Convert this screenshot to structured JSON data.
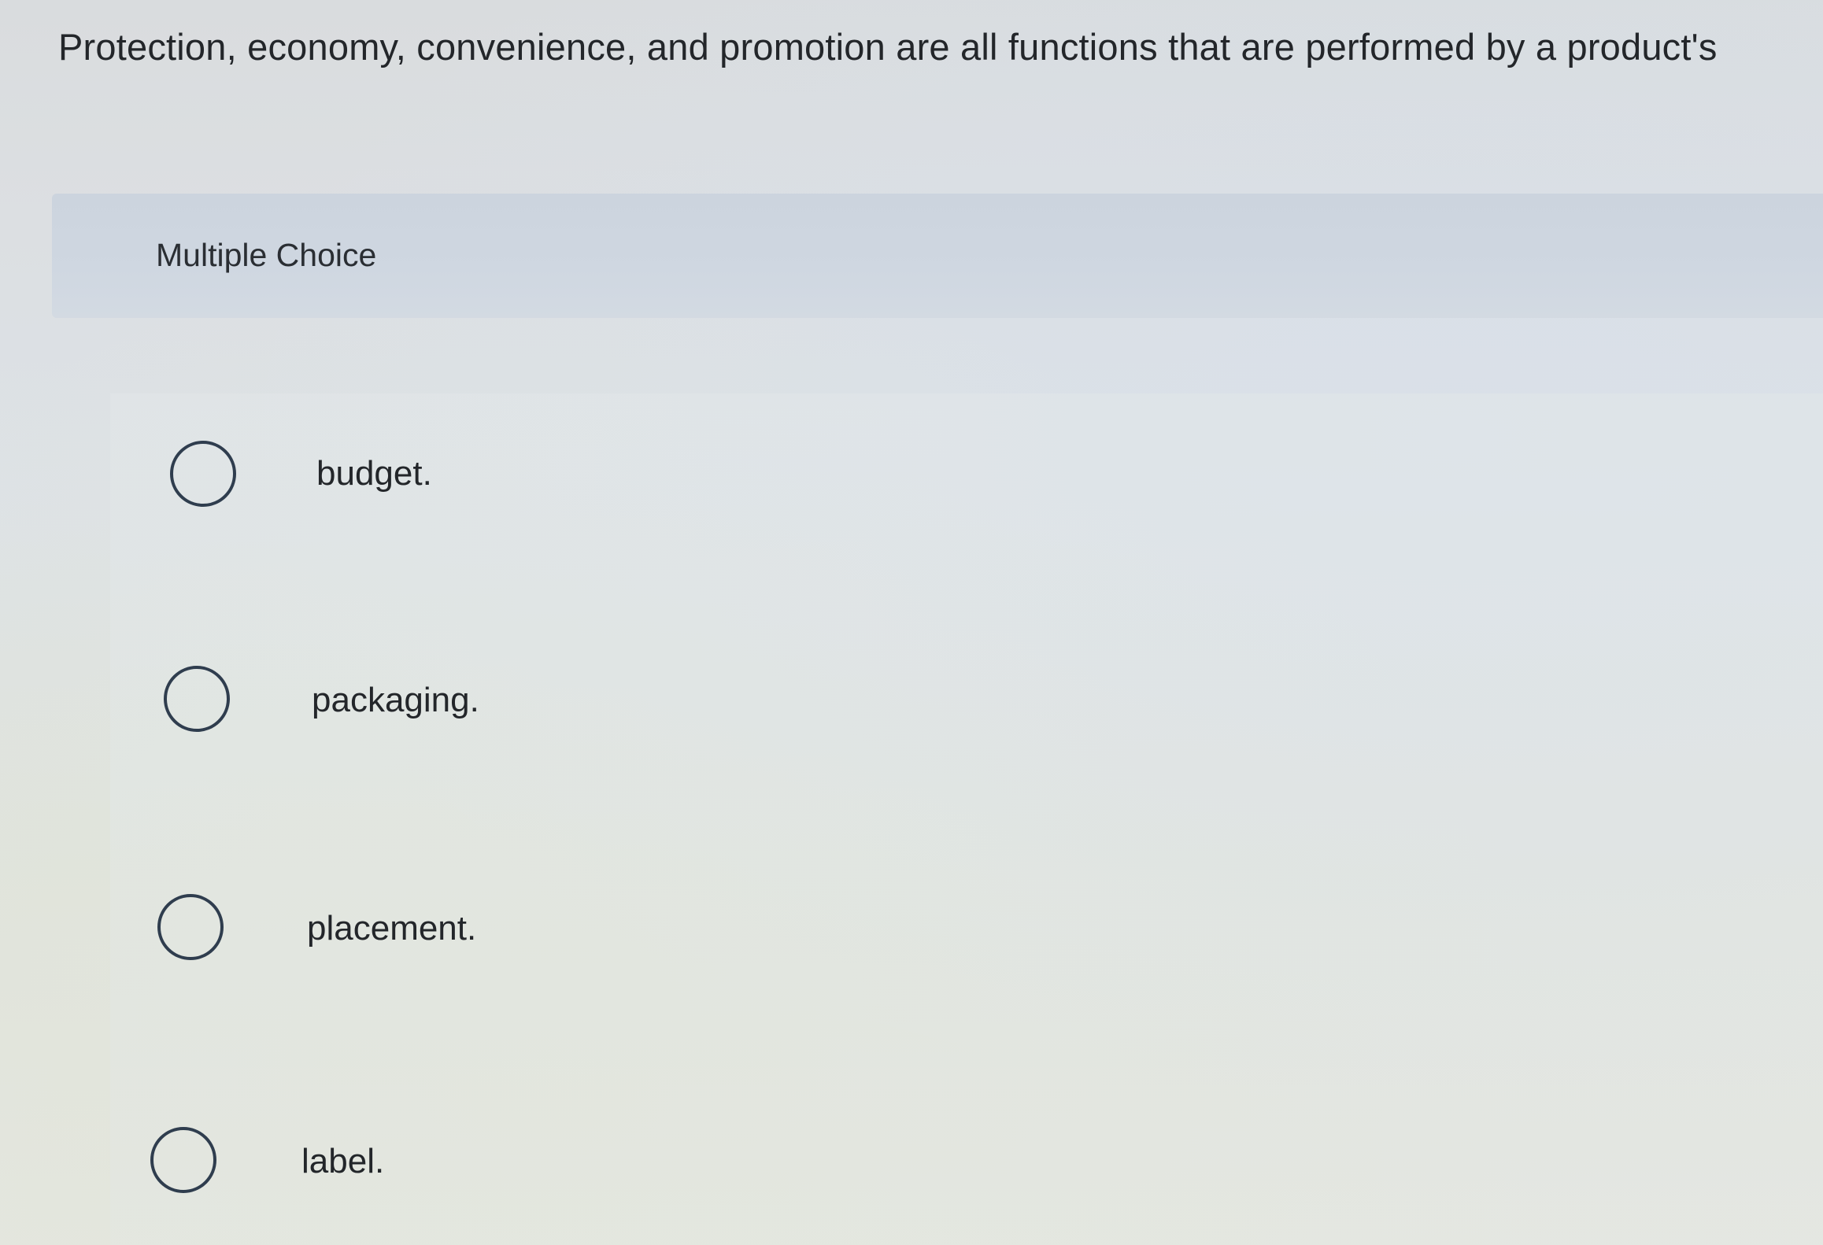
{
  "question": {
    "text": "Protection, economy, convenience, and promotion are all functions that are performed by a product's"
  },
  "section": {
    "label": "Multiple Choice"
  },
  "options": [
    {
      "label": "budget.",
      "selected": false
    },
    {
      "label": "packaging.",
      "selected": false
    },
    {
      "label": "placement.",
      "selected": false
    },
    {
      "label": "label.",
      "selected": false
    }
  ],
  "colors": {
    "header_band": "#cfd7e1",
    "radio_stroke": "#2f3d4e",
    "text": "#23262a"
  }
}
